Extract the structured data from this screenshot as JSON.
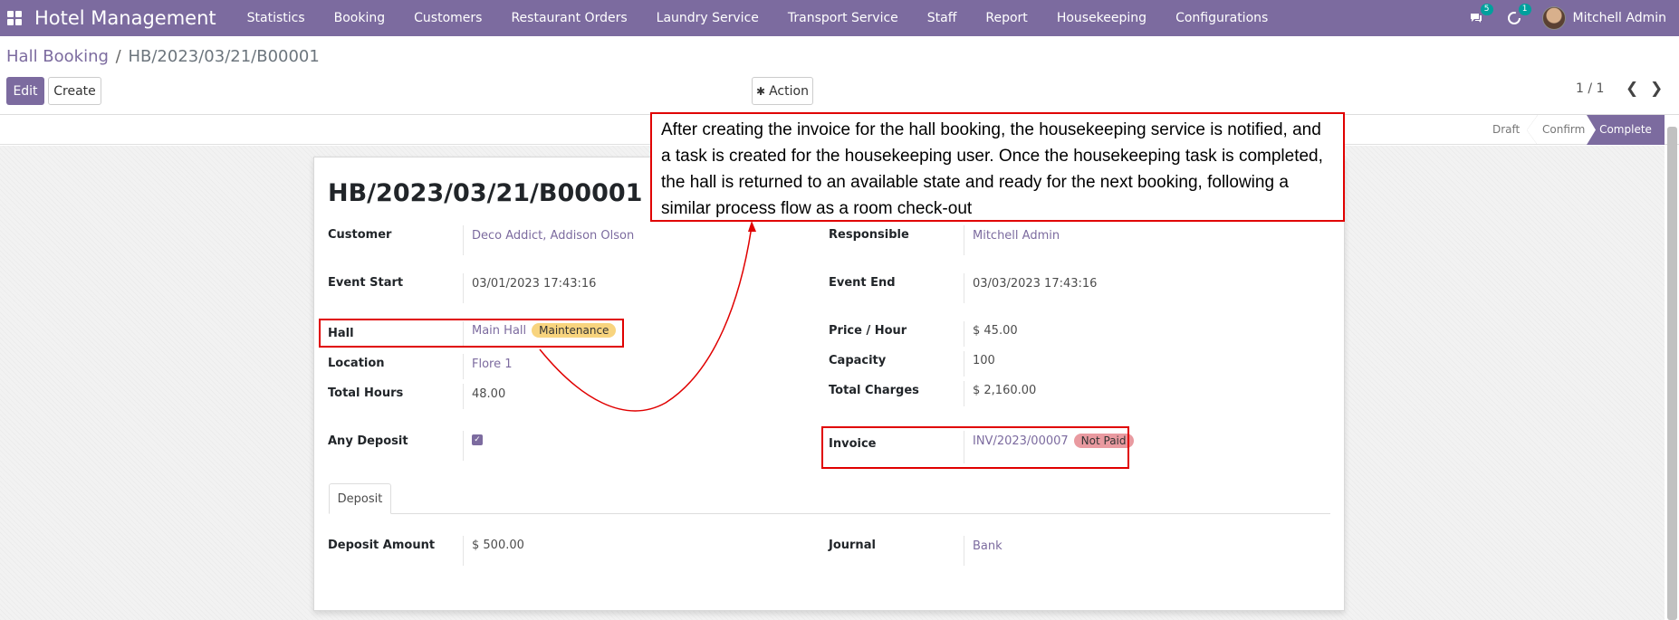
{
  "navbar": {
    "brand": "Hotel Management",
    "menu": [
      "Statistics",
      "Booking",
      "Customers",
      "Restaurant Orders",
      "Laundry Service",
      "Transport Service",
      "Staff",
      "Report",
      "Housekeeping",
      "Configurations"
    ],
    "messages_count": "5",
    "activities_count": "1",
    "user_name": "Mitchell Admin"
  },
  "breadcrumb": {
    "parent": "Hall Booking",
    "separator": "/",
    "current": "HB/2023/03/21/B00001"
  },
  "toolbar": {
    "edit": "Edit",
    "create": "Create",
    "action": "Action"
  },
  "pager": {
    "value": "1 / 1"
  },
  "statusbar": {
    "stages": [
      "Draft",
      "Confirm",
      "Complete"
    ],
    "active": "Complete"
  },
  "form": {
    "title": "HB/2023/03/21/B00001",
    "customer": {
      "label": "Customer",
      "value": "Deco Addict, Addison Olson"
    },
    "responsible": {
      "label": "Responsible",
      "value": "Mitchell Admin"
    },
    "event_start": {
      "label": "Event Start",
      "value": "03/01/2023 17:43:16"
    },
    "event_end": {
      "label": "Event End",
      "value": "03/03/2023 17:43:16"
    },
    "hall": {
      "label": "Hall",
      "value": "Main Hall",
      "tag": "Maintenance"
    },
    "price_hour": {
      "label": "Price / Hour",
      "value": "$ 45.00"
    },
    "location": {
      "label": "Location",
      "value": "Flore 1"
    },
    "capacity": {
      "label": "Capacity",
      "value": "100"
    },
    "total_hours": {
      "label": "Total Hours",
      "value": "48.00"
    },
    "total_charges": {
      "label": "Total Charges",
      "value": "$ 2,160.00"
    },
    "any_deposit": {
      "label": "Any Deposit",
      "checked": true
    },
    "invoice": {
      "label": "Invoice",
      "value": "INV/2023/00007",
      "tag": "Not Paid"
    },
    "tab": "Deposit",
    "deposit_amount": {
      "label": "Deposit Amount",
      "value": "$ 500.00"
    },
    "journal": {
      "label": "Journal",
      "value": "Bank"
    }
  },
  "annotation": {
    "text": "After creating the invoice for the hall booking, the housekeeping service is notified, and a task is created for the housekeeping user. Once the housekeeping task is completed, the hall is returned to an available state and ready for the next booking, following a similar process flow as a room check-out"
  },
  "colors": {
    "brand": "#7c6b9f",
    "annotation": "#e00000",
    "tag_maintenance": "#f8d47e",
    "tag_not_paid": "#e99aa0"
  }
}
